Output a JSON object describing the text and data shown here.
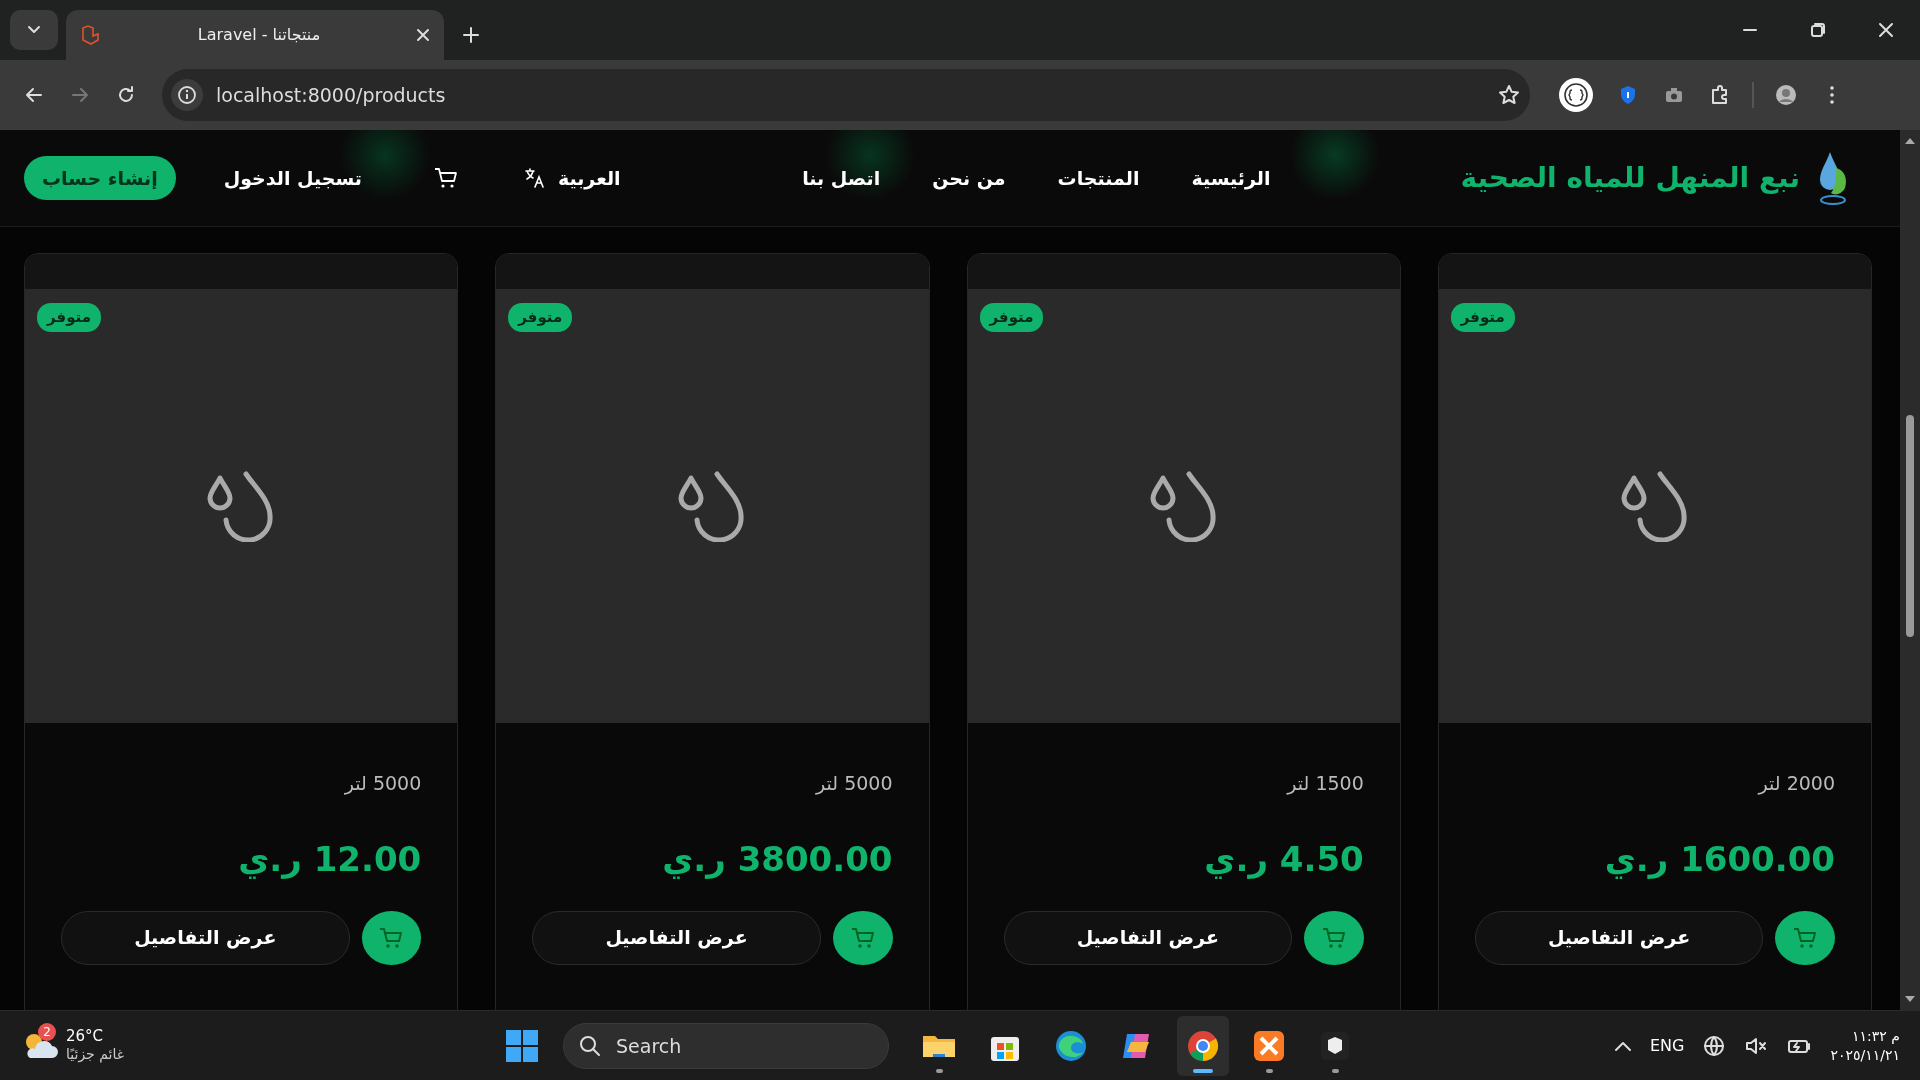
{
  "browser": {
    "tabs": [
      {
        "title": "Laravel - منتجاتنا",
        "selected": true
      }
    ],
    "address": "localhost:8000/products",
    "forward_disabled": true
  },
  "site": {
    "brand": "نبع المنهل للمياه الصحية",
    "nav": [
      {
        "label": "الرئيسية"
      },
      {
        "label": "المنتجات"
      },
      {
        "label": "من نحن"
      },
      {
        "label": "اتصل بنا"
      }
    ],
    "language": "العربية",
    "login": "تسجيل الدخول",
    "register": "إنشاء حساب"
  },
  "products": [
    {
      "badge": "متوفر",
      "volume": "2000 لتر",
      "price": "1600.00 ر.ي",
      "details": "عرض التفاصيل"
    },
    {
      "badge": "متوفر",
      "volume": "1500 لتر",
      "price": "4.50 ر.ي",
      "details": "عرض التفاصيل"
    },
    {
      "badge": "متوفر",
      "volume": "5000 لتر",
      "price": "3800.00 ر.ي",
      "details": "عرض التفاصيل"
    },
    {
      "badge": "متوفر",
      "volume": "5000 لتر",
      "price": "12.00 ر.ي",
      "details": "عرض التفاصيل"
    }
  ],
  "taskbar": {
    "weather": {
      "temp": "26°C",
      "condition": "غائم جزئيًا",
      "alerts": "2"
    },
    "search": {
      "placeholder": "Search"
    },
    "apps": [
      {
        "kind": "explorer",
        "running": true,
        "active": false
      },
      {
        "kind": "store",
        "running": false,
        "active": false
      },
      {
        "kind": "edge",
        "running": false,
        "active": false
      },
      {
        "kind": "copilot",
        "running": false,
        "active": false
      },
      {
        "kind": "chrome",
        "running": true,
        "active": true
      },
      {
        "kind": "xampp",
        "running": true,
        "active": false
      },
      {
        "kind": "terminal",
        "running": true,
        "active": false
      }
    ],
    "language": "ENG",
    "time": "١١:٣٢ م",
    "date": "٢٠٢٥/١١/٢١"
  }
}
